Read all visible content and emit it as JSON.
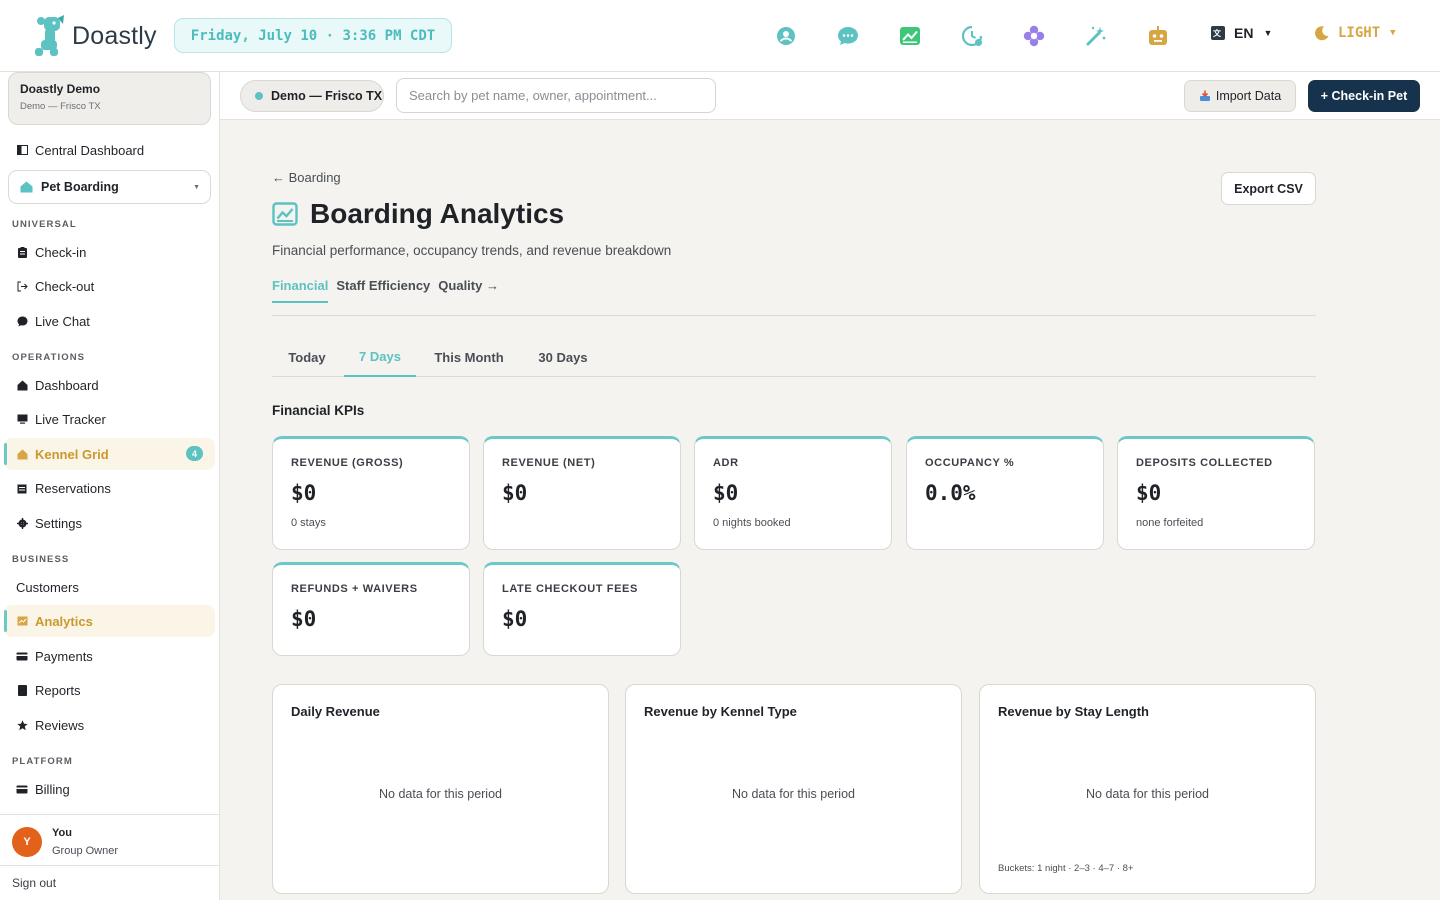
{
  "app": {
    "brand": "Doastly",
    "datetime": "Friday, July 10 · 3:36 PM CDT",
    "lang": "EN",
    "theme": "LIGHT",
    "colors": {
      "accent": "#5cc2c2",
      "navy": "#17324d",
      "gold": "#c9992e"
    }
  },
  "topbar": {
    "icons": [
      "support-icon",
      "chat-icon",
      "analytics-icon",
      "clock-icon",
      "flower-icon",
      "magic-wand-icon",
      "robot-icon"
    ]
  },
  "sidebar": {
    "org": {
      "name": "Doastly Demo",
      "sub": "Demo — Frisco TX"
    },
    "central_dashboard": "Central Dashboard",
    "module": "Pet Boarding",
    "sections": {
      "universal": "UNIVERSAL",
      "operations": "OPERATIONS",
      "business": "BUSINESS",
      "platform": "PLATFORM"
    },
    "items": {
      "checkin": "Check-in",
      "checkout": "Check-out",
      "livechat": "Live Chat",
      "dashboard": "Dashboard",
      "livetracker": "Live Tracker",
      "kennelgrid": "Kennel Grid",
      "kennelgrid_badge": "4",
      "reservations": "Reservations",
      "settings": "Settings",
      "customers": "Customers",
      "analytics": "Analytics",
      "payments": "Payments",
      "reports": "Reports",
      "reviews": "Reviews",
      "billing": "Billing"
    },
    "user": {
      "initial": "Y",
      "name": "You",
      "role": "Group Owner"
    },
    "signout": "Sign out"
  },
  "subbar": {
    "location": "Demo — Frisco TX",
    "search_placeholder": "Search by pet name, owner, appointment...",
    "import": "Import Data",
    "checkin": "+ Check-in Pet"
  },
  "page": {
    "back": "← Boarding",
    "export": "Export CSV",
    "title": "Boarding Analytics",
    "description": "Financial performance, occupancy trends, and revenue breakdown",
    "view_tabs": [
      "Financial",
      "Staff Efficiency",
      "Quality →"
    ],
    "period_tabs": [
      "Today",
      "7 Days",
      "This Month",
      "30 Days"
    ],
    "kpi_section": "Financial KPIs",
    "kpis": [
      {
        "label": "REVENUE (GROSS)",
        "value": "$0",
        "sub": "0 stays"
      },
      {
        "label": "REVENUE (NET)",
        "value": "$0",
        "sub": ""
      },
      {
        "label": "ADR",
        "value": "$0",
        "sub": "0 nights booked"
      },
      {
        "label": "OCCUPANCY %",
        "value": "0.0%",
        "sub": ""
      },
      {
        "label": "DEPOSITS COLLECTED",
        "value": "$0",
        "sub": "none forfeited"
      },
      {
        "label": "REFUNDS + WAIVERS",
        "value": "$0",
        "sub": ""
      },
      {
        "label": "LATE CHECKOUT FEES",
        "value": "$0",
        "sub": ""
      }
    ],
    "charts": [
      {
        "title": "Daily Revenue",
        "empty": "No data for this period",
        "foot": ""
      },
      {
        "title": "Revenue by Kennel Type",
        "empty": "No data for this period",
        "foot": ""
      },
      {
        "title": "Revenue by Stay Length",
        "empty": "No data for this period",
        "foot": "Buckets: 1 night · 2–3 · 4–7 · 8+"
      }
    ]
  }
}
